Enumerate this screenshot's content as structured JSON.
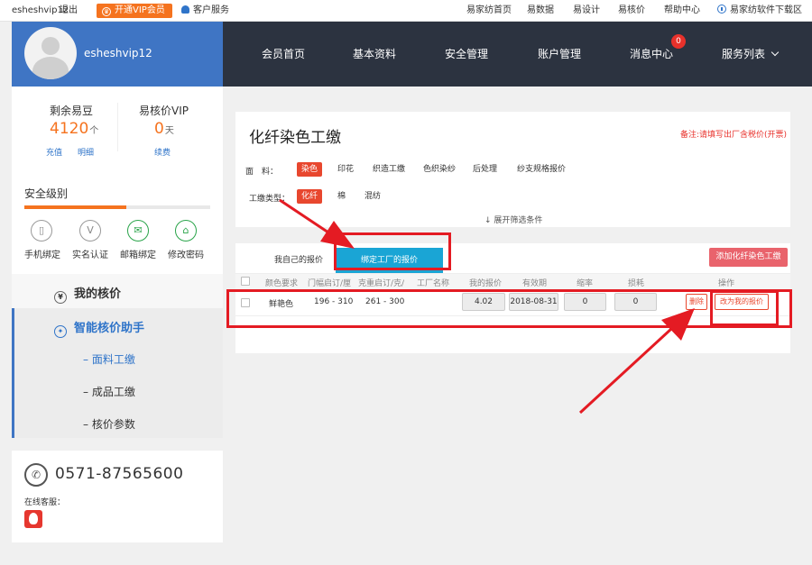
{
  "topbar": {
    "username": "esheshvip12",
    "logout": "退出",
    "vip_button": "开通VIP会员",
    "customer_service": "客户服务",
    "links": [
      "易家纺首页",
      "易数据",
      "易设计",
      "易核价",
      "帮助中心"
    ],
    "download": "易家纺软件下载区"
  },
  "header": {
    "username": "esheshvip12",
    "nav": [
      "会员首页",
      "基本资料",
      "安全管理",
      "账户管理",
      "消息中心",
      "服务列表"
    ],
    "message_badge": "0"
  },
  "sidebar": {
    "beans_label": "剩余易豆",
    "beans_value": "4120",
    "beans_unit": "个",
    "recharge": "充值",
    "detail": "明细",
    "vip_label": "易核价VIP",
    "vip_value": "0",
    "vip_unit": "天",
    "renew": "续费",
    "security_label": "安全级别",
    "security_level": 0.55,
    "security_items": [
      "手机绑定",
      "实名认证",
      "邮箱绑定",
      "修改密码"
    ],
    "menu_my_price": "我的核价",
    "menu_assistant": "智能核价助手",
    "sub_items": [
      "面料工缴",
      "成品工缴",
      "核价参数"
    ],
    "phone": "0571-87565600",
    "online_service": "在线客服："
  },
  "filter": {
    "title": "化纤染色工缴",
    "note": "备注:请填写出厂含税价(开票)",
    "fabric_label": "面　料：",
    "fabric_options": [
      "染色",
      "印花",
      "织造工缴",
      "色织染纱",
      "后处理",
      "纱支规格报价"
    ],
    "fabric_selected": "染色",
    "type_label": "工缴类型：",
    "type_options": [
      "化纤",
      "棉",
      "混纺"
    ],
    "type_selected": "化纤",
    "expand": "↓ 展开筛选条件"
  },
  "list": {
    "tab_own": "我自己的报价",
    "tab_bind": "绑定工厂的报价",
    "add_button": "添加化纤染色工缴",
    "headers": [
      "颜色要求",
      "门幅启订/厘",
      "克重启订/克/",
      "工厂名称",
      "我的报价",
      "有效期",
      "缩率",
      "损耗",
      "操作"
    ],
    "rows": [
      {
        "color": "鲜艳色",
        "width": "196 - 310",
        "weight": "261 - 300",
        "factory": "",
        "price": "4.02",
        "valid": "2018-08-31",
        "shrink": "0",
        "loss": "0",
        "delete": "删除",
        "change": "改为我的报价"
      }
    ]
  }
}
